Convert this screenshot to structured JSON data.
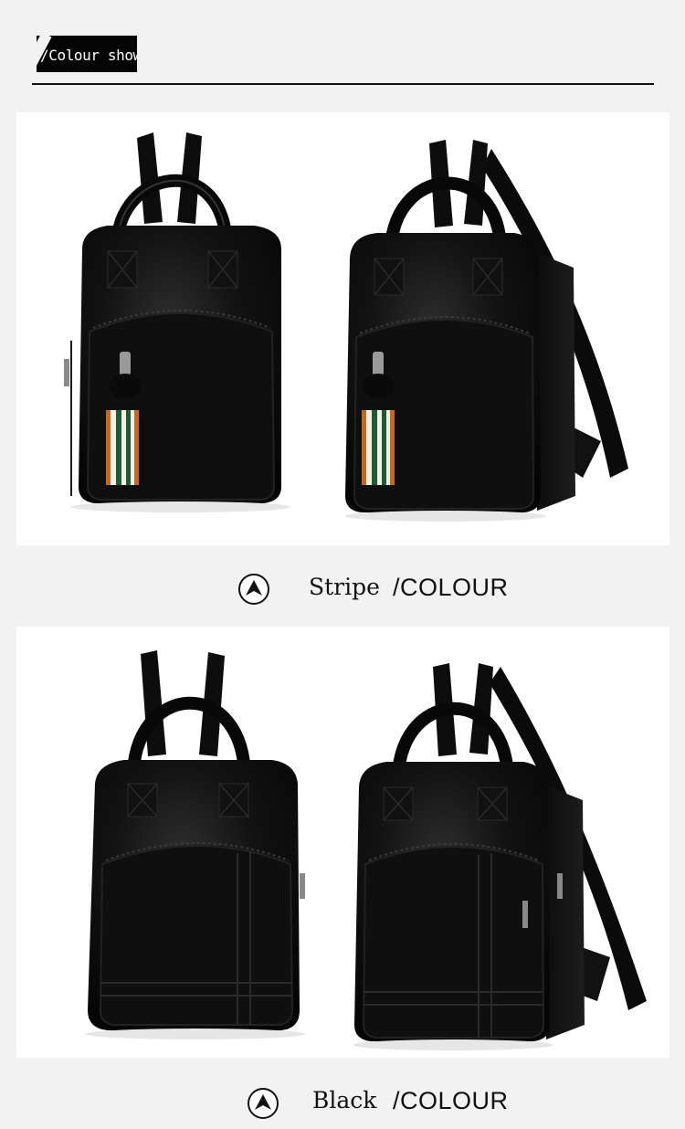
{
  "header": {
    "title": "/Colour show"
  },
  "sections": [
    {
      "color_name": "Stripe",
      "suffix": "/COLOUR",
      "images": [
        "backpack-stripe-front",
        "backpack-stripe-angle"
      ]
    },
    {
      "color_name": "Black",
      "suffix": "/COLOUR",
      "images": [
        "backpack-black-front",
        "backpack-black-angle"
      ]
    }
  ],
  "colors": {
    "background": "#f2f2f2",
    "panel": "#ffffff",
    "bag": "#0c0c0c",
    "stripe_green": "#1f5a35",
    "stripe_orange": "#c46a1a",
    "stripe_white": "#f4f1e8"
  },
  "icons": {
    "caption_marker": "circle-up-arrow-icon"
  }
}
